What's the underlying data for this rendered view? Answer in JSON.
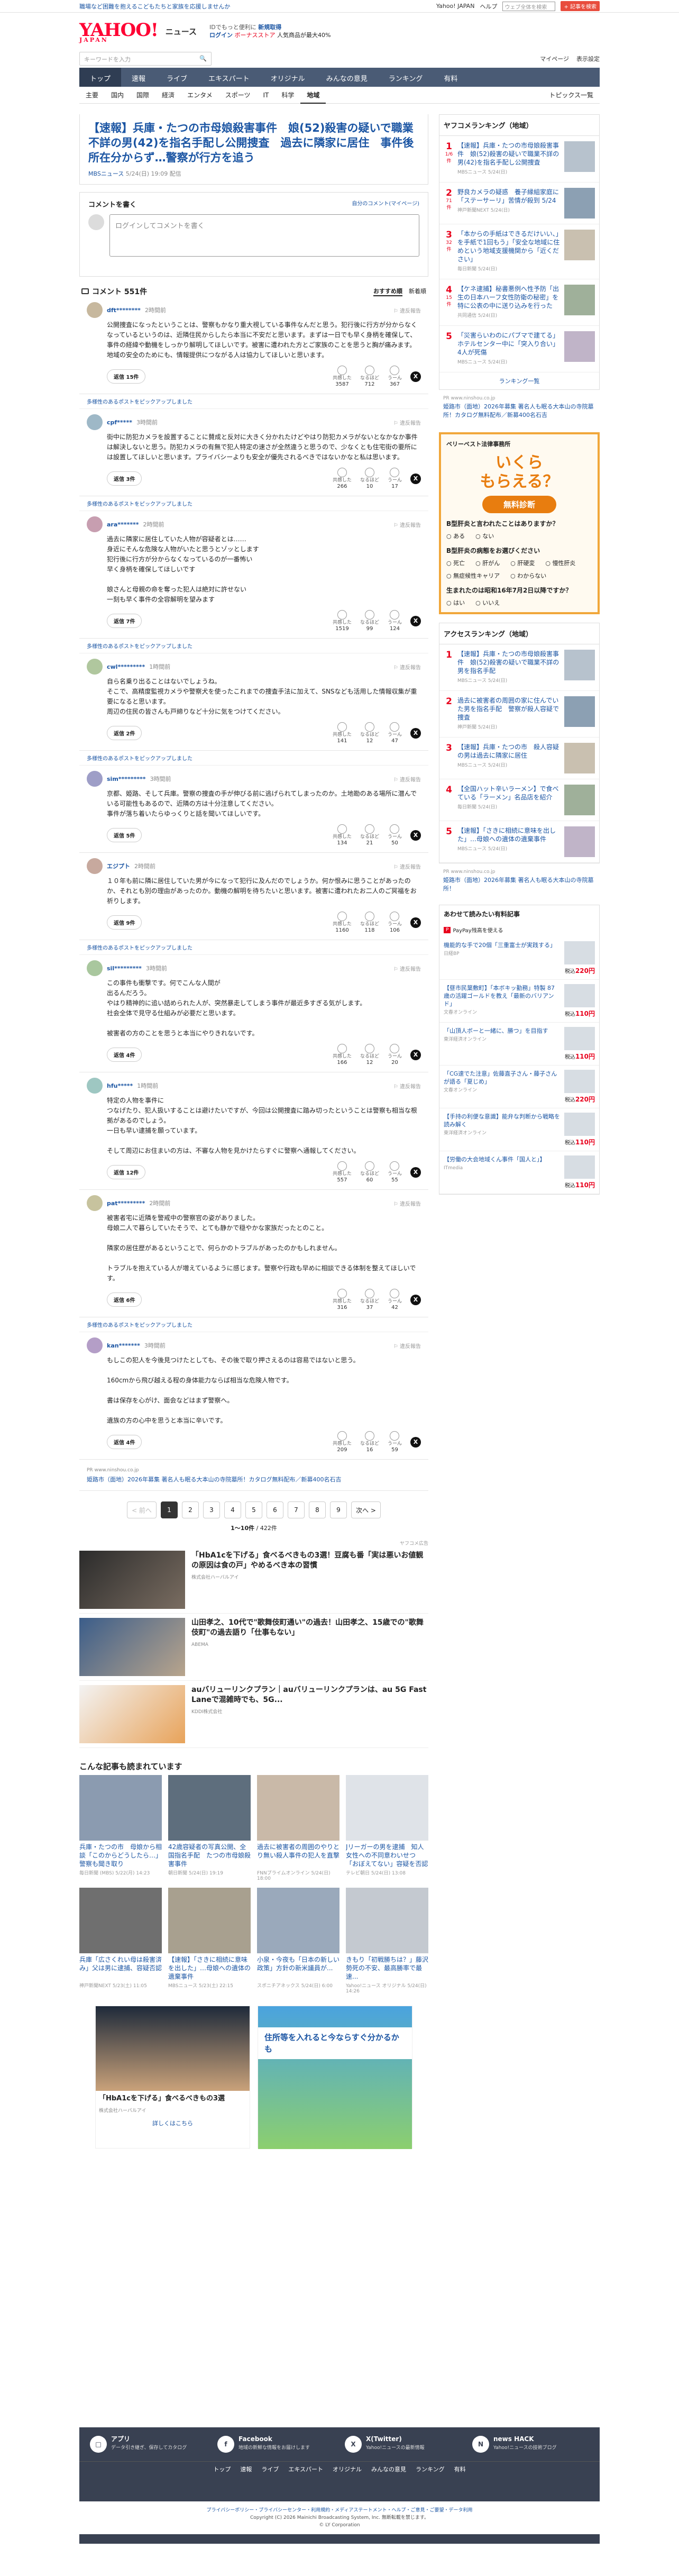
{
  "promo": {
    "left": "職場など困難を抱えるこどもたちと家族を応援しませんか",
    "links": [
      "Yahoo! JAPAN",
      "ヘルプ"
    ],
    "search_placeholder": "ウェブ全体を検索",
    "search_btn": "+ 記事を検索"
  },
  "header": {
    "logo": "YAHOO!",
    "logo_sub": "JAPAN",
    "news": "ニュース",
    "info_l1": "IDでもっと便利に",
    "info_l1b": "新規取得",
    "info_l2a": "ログイン",
    "info_l2b": "ボーナスストア",
    "info_l2c": "人気商品が最大40%"
  },
  "search": {
    "placeholder": "キーワードを入力",
    "mypage": "マイページ",
    "settings": "表示設定"
  },
  "nav_tabs": [
    "トップ",
    "速報",
    "ライブ",
    "エキスパート",
    "オリジナル",
    "みんなの意見",
    "ランキング",
    "有料"
  ],
  "nav_sub": [
    "主要",
    "国内",
    "国際",
    "経済",
    "エンタメ",
    "スポーツ",
    "IT",
    "科学",
    "地域"
  ],
  "nav_sub_active": "地域",
  "nav_topics": "トピックス一覧",
  "article": {
    "title": "【速報】兵庫・たつの市母娘殺害事件　娘(52)殺害の疑いで職業不詳の男(42)を指名手配し公開捜査　過去に隣家に居住　事件後所在分からず…警察が行方を追う",
    "source": "MBSニュース",
    "date": "5/24(日) 19:09 配信"
  },
  "comment_form": {
    "title": "コメントを書く",
    "my_comments": "自分のコメント(マイページ)",
    "placeholder": "ログインしてコメントを書く"
  },
  "comments_header": {
    "label": "コメント 551件",
    "sort": [
      "おすすめ順",
      "新着順"
    ]
  },
  "comments": [
    {
      "user": "dft********",
      "time": "2時間前",
      "body": "公開捜査になったということは、警察もかなり重大視している事件なんだと思う。犯行後に行方が分からなくなっているというのは、近隣住民からしたら本当に不安だと思います。まずは一日でも早く身柄を確保して、事件の経緯や動機をしっかり解明してほしいです。被害に遭われた方とご家族のことを思うと胸が痛みます。地域の安全のためにも、情報提供につながる人は協力してほしいと思います。",
      "reply": "返信 15件",
      "likes": "3587",
      "neutral": "712",
      "dislike": "367",
      "expert": "多様性のあるポストをピックアップしました"
    },
    {
      "user": "cpf*****",
      "time": "3時間前",
      "body": "街中に防犯カメラを設置することに賛成と反対に大きく分かれたけどやはり防犯カメラがないとなかなか事件は解決しないと思う。防犯カメラの有無で犯人特定の速さが全然違うと思うので、少なくとも住宅街の要所には設置してほしいと思います。プライバシーよりも安全が優先されるべきではないかなと私は思います。",
      "reply": "返信 3件",
      "likes": "266",
      "neutral": "10",
      "dislike": "17",
      "expert": "多様性のあるポストをピックアップしました"
    },
    {
      "user": "ara*******",
      "time": "2時間前",
      "body": "過去に隣家に居住していた人物が容疑者とは……\n身近にそんな危険な人物がいたと思うとゾッとします\n犯行後に行方が分からなくなっているのが一番怖い\n早く身柄を確保してほしいです\n\n娘さんと母親の命を奪った犯人は絶対に許せない\n一刻も早く事件の全容解明を望みます",
      "reply": "返信 7件",
      "likes": "1519",
      "neutral": "99",
      "dislike": "124",
      "expert": "多様性のあるポストをピックアップしました"
    },
    {
      "user": "cwl*********",
      "time": "1時間前",
      "body": "自ら名乗り出ることはないでしょうね。\nそこで、高精度監視カメラや警察犬を使ったこれまでの捜査手法に加えて、SNSなども活用した情報収集が重要になると思います。\n周辺の住民の皆さんも戸締りなど十分に気をつけてください。",
      "reply": "返信 2件",
      "likes": "141",
      "neutral": "12",
      "dislike": "47",
      "expert": "多様性のあるポストをピックアップしました"
    },
    {
      "user": "sim*********",
      "time": "3時間前",
      "body": "京都、姫路、そして兵庫。警察の捜査の手が伸びる前に逃げられてしまったのか。土地勘のある場所に潜んでいる可能性もあるので、近隣の方は十分注意してください。\n事件が落ち着いたらゆっくりと話を聞いてほしいです。",
      "reply": "返信 5件",
      "likes": "134",
      "neutral": "21",
      "dislike": "50",
      "expert": ""
    },
    {
      "user": "エジプト",
      "time": "2時間前",
      "body": "１０年も前に隣に居住していた男が今になって犯行に及んだのでしょうか。何か恨みに思うことがあったのか、それとも別の理由があったのか。動機の解明を待ちたいと思います。被害に遭われたお二人のご冥福をお祈りします。",
      "reply": "返信 9件",
      "likes": "1160",
      "neutral": "118",
      "dislike": "106",
      "expert": "多様性のあるポストをピックアップしました"
    },
    {
      "user": "sil*********",
      "time": "3時間前",
      "body": "この事件も衝撃です。何でこんな人間が\n出るんだろう。\nやはり精神的に追い詰められた人が、突然暴走してしまう事件が最近多すぎる気がします。\n社会全体で見守る仕組みが必要だと思います。\n\n被害者の方のことを思うと本当にやりきれないです。",
      "reply": "返信 4件",
      "likes": "166",
      "neutral": "12",
      "dislike": "20",
      "expert": ""
    },
    {
      "user": "hfu*****",
      "time": "1時間前",
      "body": "特定の人物を事件に\nつなげたり、犯人扱いすることは避けたいですが、今回は公開捜査に踏み切ったということは警察も相当な根拠があるのでしょう。\n一日も早い逮捕を願っています。\n\nそして周辺にお住まいの方は、不審な人物を見かけたらすぐに警察へ通報してください。",
      "reply": "返信 12件",
      "likes": "557",
      "neutral": "60",
      "dislike": "55",
      "expert": ""
    },
    {
      "user": "pat*********",
      "time": "2時間前",
      "body": "被害者宅に近隣を警戒中の警察官の姿がありました。\n母娘二人で暮らしていたそうで、とても静かで穏やかな家族だったとのこと。\n\n隣家の居住歴があるということで、何らかのトラブルがあったのかもしれません。\n\nトラブルを抱えている人が増えているように感じます。警察や行政も早めに相談できる体制を整えてほしいです。",
      "reply": "返信 6件",
      "likes": "316",
      "neutral": "37",
      "dislike": "42",
      "expert": "多様性のあるポストをピックアップしました"
    },
    {
      "user": "kan*******",
      "time": "3時間前",
      "body": "もしこの犯人を今後見つけたとしても、その後で取り押さえるのは容易ではないと思う。\n\n160cmから飛び越える程の身体能力ならば相当な危険人物です。\n\n書は保存を心がけ、面会などはまず警察へ。\n\n遺族の方の心中を思うと本当に辛いです。",
      "reply": "返信 4件",
      "likes": "209",
      "neutral": "16",
      "dislike": "59",
      "expert": ""
    }
  ],
  "inline_ad": {
    "src": "PR www.ninshou.co.jp",
    "text": "姫路市（面地）2026年募集 著名人も眠る大本山の寺院墓所！カタログ無料配布／新募400名石吉"
  },
  "pager": {
    "prev": "< 前へ",
    "pages": [
      "1",
      "2",
      "3",
      "4",
      "5",
      "6",
      "7",
      "8",
      "9"
    ],
    "next": "次へ >",
    "count_a": "1〜10件",
    "count_b": "/ 422件"
  },
  "ads": {
    "label": "ヤフコメ広告",
    "items": [
      {
        "title": "「HbA1cを下げる」食べるべきもの3選！豆腐も番「実は悪いお値観の原因は食の戸」やめるべき本の習慣",
        "sponsor": "株式会社ハーバルアイ"
      },
      {
        "title": "山田孝之、10代で\"歌舞伎町通い\"の過去！山田孝之、15歳での\"歌舞伎町\"の過去語り「仕事もない」",
        "sponsor": "ABEMA"
      },
      {
        "title": "auバリューリンクプラン｜auバリューリンクプランは、au 5G Fast Laneで混雑時でも、5G...",
        "sponsor": "KDDI株式会社"
      }
    ]
  },
  "related": {
    "title": "こんな記事も読まれています",
    "items": [
      {
        "title": "兵庫・たつの市　母娘から相談「このからどうしたら…」警察も聞き取り",
        "source": "毎日新聞 (MBS)",
        "date": "5/22(月) 14:23"
      },
      {
        "title": "42歳容疑者の写真公開、全国指名手配　たつの市母娘殺害事件",
        "source": "朝日新聞",
        "date": "5/24(日) 19:19"
      },
      {
        "title": "過去に被害者の周囲のやりとり無い殺人事件の犯人を直撃",
        "source": "FNNプライムオンライン",
        "date": "5/24(日) 18:00"
      },
      {
        "title": "Jリーガーの男を逮捕　知人女性への不同意わいせつ　「おぼえてない」容疑を否認",
        "source": "テレビ朝日",
        "date": "5/24(日) 13:08"
      },
      {
        "title": "兵庫「広さくれい母は殺害済み」父は男に逮捕、容疑否認",
        "source": "神戸新聞NEXT",
        "date": "5/23(土) 11:05"
      },
      {
        "title": "【速報】「さきに相続に意味を出した」…母娘への遺体の遺棄事件",
        "source": "MBSニュース",
        "date": "5/23(土) 22:15"
      },
      {
        "title": "小泉・今夜も「日本の新しい政策」方針の新米議員が...",
        "source": "スポニチアネックス",
        "date": "5/24(日) 6:00"
      },
      {
        "title": "きもり「初戦勝ちは？」藤沢勢死の不安、最高勝率で最速...",
        "source": "Yahoo!ニュース オリジナル",
        "date": "5/24(日) 14:26"
      }
    ]
  },
  "bottom_ads": [
    {
      "title": "「HbA1cを下げる」食べるべきもの3選",
      "sponsor": "株式会社ハーバルアイ",
      "more": "詳しくはこちら"
    },
    {
      "title": "住所等を入れると今ならすぐ分かるかも",
      "sponsor": "",
      "more": ""
    }
  ],
  "sidebar": {
    "ranking_title": "ヤフコメランキング（地域）",
    "ranking": [
      {
        "n": "1",
        "sub": "1/6件",
        "title": "【速報】兵庫・たつの市母娘殺害事件　娘(52)殺害の疑いで職業不詳の男(42)を指名手配し公開捜査",
        "meta": "MBSニュース 5/24(日)"
      },
      {
        "n": "2",
        "sub": "71件",
        "title": "野良カメラの疑惑　養子縁組家庭に「ステーサーリ」苦情が殺到 5/24",
        "meta": "神戸新聞NEXT 5/24(日)"
      },
      {
        "n": "3",
        "sub": "32件",
        "title": "「本からの手紙はできるだけいい、」を手紙で1回もう」「安全な地域に住めという地域支援機関から「近ください」",
        "meta": "毎日新聞 5/24(日)"
      },
      {
        "n": "4",
        "sub": "15件",
        "title": "【ケネ逮捕】秘書悪例へ性予防「出生の日本ハーフ女性防衛の秘密」を特に公表の中に送り込みを行った",
        "meta": "共同通信 5/24(日)"
      },
      {
        "n": "5",
        "sub": "",
        "title": "「災害らいわのにパブマで建てる」ホテルセンター中に「突入り合い」4人が死傷",
        "meta": "MBSニュース 5/24(日)"
      }
    ],
    "ranking_more": "ランキング一覧",
    "pr1": {
      "src": "PR www.ninshou.co.jp",
      "text": "姫路市（面地）2026年募集 著名人も眠る大本山の寺院墓所！カタログ無料配布／新募400名石吉"
    },
    "survey": {
      "brand": "ベリーベスト法律事務所",
      "big": "いくら\nもらえる？",
      "diag": "無料診断",
      "q1": "B型肝炎と言われたことはありますか？",
      "q1_opts": [
        "ある",
        "ない"
      ],
      "q2": "B型肝炎の病態をお選びください",
      "q2_opts": [
        "死亡",
        "肝がん",
        "肝硬変",
        "慢性肝炎",
        "無症候性キャリア",
        "わからない"
      ],
      "q3": "生まれたのは昭和16年7月2日以降ですか？",
      "q3_opts": [
        "はい",
        "いいえ"
      ]
    },
    "access_title": "アクセスランキング（地域）",
    "access": [
      {
        "n": "1",
        "title": "【速報】兵庫・たつの市母娘殺害事件　娘(52)殺害の疑いで職業不詳の男を指名手配",
        "meta": "MBSニュース 5/24(日)"
      },
      {
        "n": "2",
        "title": "過去に被害者の周囲の家に住んでいた男を指名手配　警察が殺人容疑で捜査",
        "meta": "神戸新聞 5/24(日)"
      },
      {
        "n": "3",
        "title": "【速報】兵庫・たつの市　殺人容疑の男は過去に隣家に居住",
        "meta": "MBSニュース 5/24(日)"
      },
      {
        "n": "4",
        "title": "【全国ハット辛いラーメン】で食べている「ラーメン」名品店を紹介",
        "meta": "毎日新聞 5/24(日)"
      },
      {
        "n": "5",
        "title": "【速報】「さきに相続に意味を出した」…母娘への遺体の遺棄事件",
        "meta": "MBSニュース 5/24(日)"
      }
    ],
    "pr2": {
      "src": "PR www.ninshou.co.jp",
      "text": "姫路市（面地）2026年募集 著名人も眠る大本山の寺院墓所！"
    },
    "shop_title": "あわせて読みたい有料記事",
    "paypay": "PayPay残高を使える",
    "shop": [
      {
        "title": "機能的な手で20個「三重富士が実践する」",
        "meta": "日経BP",
        "price": "220円"
      },
      {
        "title": "【昼市民葉敷町】「本ボキッ勤務」特製 87歳の活躍ゴールドを教え「最新のバリアンド」",
        "meta": "文春オンライン",
        "price": "110円"
      },
      {
        "title": "「山頂人ボーと一緒に、勝つ」を目指す",
        "meta": "東洋経済オンライン",
        "price": "110円"
      },
      {
        "title": "「CG速でた注意」佐藤直子さん・藤子さんが語る「夏じめ」",
        "meta": "文春オンライン",
        "price": "220円"
      },
      {
        "title": "【手持の利便な意識】能弁な判断から戦略を読み解く",
        "meta": "東洋経済オンライン",
        "price": "110円"
      },
      {
        "title": "【労働の大会地域くん事件「国人と」】",
        "meta": "ITmedia",
        "price": "110円"
      }
    ]
  },
  "footer": {
    "cols": [
      {
        "t": "アプリ",
        "d": "データ引き継ぎ、保存してカタログ"
      },
      {
        "t": "Facebook",
        "d": "地域の新鮮な情報をお届けします"
      },
      {
        "t": "X(Twitter)",
        "d": "Yahoo!ニュースの最新情報"
      },
      {
        "t": "news HACK",
        "d": "Yahoo!ニュースの技術ブログ"
      }
    ],
    "nav": [
      "トップ",
      "速報",
      "ライブ",
      "エキスパート",
      "オリジナル",
      "みんなの意見",
      "ランキング",
      "有料"
    ],
    "legal1": "プライバシーポリシー・プライバシーセンター・利用規約・メディアステートメント・ヘルプ・ご意見・ご要望・データ利用",
    "legal2": "Copyright (C) 2026 Mainichi Broadcasting System, Inc. 無断転載を禁じます。",
    "legal3": "© LY Corporation"
  }
}
